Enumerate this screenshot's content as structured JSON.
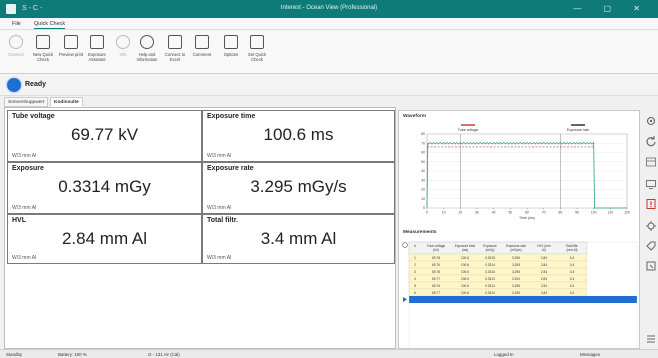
{
  "window": {
    "title": "Interest - Ocean View (Professional)",
    "quick_access": "S - C -",
    "controls": "— ▢ ✕"
  },
  "menu": {
    "items": [
      "File",
      "Quick Check"
    ]
  },
  "ribbon": {
    "buttons": [
      {
        "label": "Connect",
        "disabled": true
      },
      {
        "label": "New Quick Check",
        "disabled": false
      },
      {
        "label": "Preview print",
        "disabled": false
      },
      {
        "label": "Exposure Assistant",
        "disabled": false
      },
      {
        "label": "Info",
        "disabled": true
      },
      {
        "label": "Help and information",
        "disabled": false
      },
      {
        "label": "Connect to Excel",
        "disabled": false
      },
      {
        "label": "Comment",
        "disabled": false
      },
      {
        "label": "Options",
        "disabled": false
      },
      {
        "label": "Set Quick Check",
        "disabled": false
      }
    ]
  },
  "status": {
    "text": "Ready",
    "color": "#1e6fd0"
  },
  "tabs": [
    {
      "label": "Sonnenhuppwert",
      "active": false
    },
    {
      "label": "Kodinsulte",
      "active": true
    }
  ],
  "measurements": [
    {
      "label": "Tube voltage",
      "value": "69.77 kV",
      "unit": "W/3 mm Al"
    },
    {
      "label": "Exposure time",
      "value": "100.6 ms",
      "unit": "W/3 mm Al"
    },
    {
      "label": "Exposure",
      "value": "0.3314 mGy",
      "unit": "W/3 mm Al"
    },
    {
      "label": "Exposure rate",
      "value": "3.295 mGy/s",
      "unit": "W/3 mm Al"
    },
    {
      "label": "HVL",
      "value": "2.84 mm Al",
      "unit": "W/3 mm Al"
    },
    {
      "label": "Total filtr.",
      "value": "3.4 mm Al",
      "unit": "W/3 mm Al"
    }
  ],
  "waveform": {
    "title": "Waveform",
    "legend": [
      "Tube voltage",
      "Exposure rate"
    ],
    "colors": {
      "voltage": "#d23c3c",
      "rate": "#2a9d8f",
      "dark": "#333333"
    },
    "xlabel": "Time (ms)",
    "x_ticks": [
      "0",
      "10",
      "20",
      "30",
      "40",
      "50",
      "60",
      "70",
      "80",
      "90",
      "100",
      "110",
      "120"
    ],
    "y_ticks": [
      "0",
      "10",
      "20",
      "30",
      "40",
      "50",
      "60",
      "70",
      "80"
    ],
    "xlim": [
      0,
      120
    ],
    "ylim": [
      0,
      80
    ],
    "plateau": 70,
    "pulse_end": 100
  },
  "table": {
    "title": "Measurements",
    "headers": [
      "#",
      "Tube voltage (kV)",
      "Exposure time (ms)",
      "Exposure (mGy)",
      "Exposure rate (mGy/s)",
      "HVL (mm Al)",
      "Total filtr. (mm Al)"
    ],
    "rows": [
      [
        "1",
        "69.78",
        "100.6",
        "0.3315",
        "3.296",
        "2.84",
        "3.4"
      ],
      [
        "2",
        "69.76",
        "100.6",
        "0.3314",
        "3.295",
        "2.84",
        "3.4"
      ],
      [
        "3",
        "69.78",
        "100.6",
        "0.3316",
        "3.296",
        "2.84",
        "3.4"
      ],
      [
        "4",
        "69.77",
        "100.6",
        "0.3313",
        "3.294",
        "2.84",
        "3.4"
      ],
      [
        "5",
        "69.76",
        "100.6",
        "0.3314",
        "3.295",
        "2.84",
        "3.4"
      ],
      [
        "6",
        "69.77",
        "100.6",
        "0.3314",
        "3.295",
        "2.84",
        "3.4"
      ]
    ]
  },
  "statusbar": {
    "items": [
      "Standby",
      "Battery: 100 %",
      "O - 131 Air (Cal)",
      "Logged In",
      "Messages"
    ]
  }
}
